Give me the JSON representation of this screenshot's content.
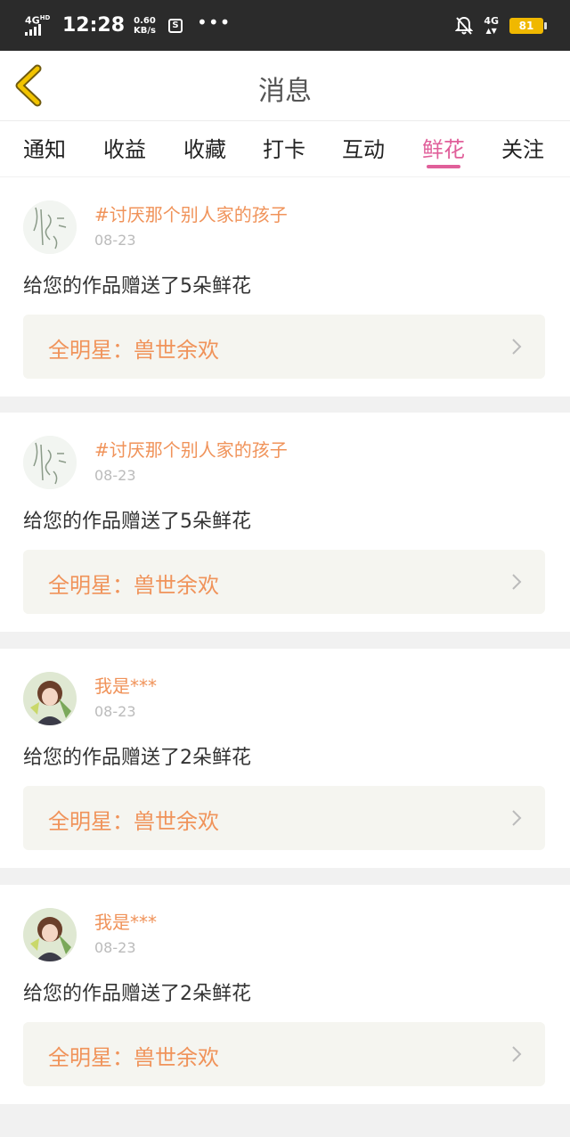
{
  "status_bar": {
    "network": "4G",
    "network_sup": "HD",
    "time": "12:28",
    "speed_value": "0.60",
    "speed_unit": "KB/s",
    "right_network": "4G",
    "battery": "81"
  },
  "header": {
    "title": "消息"
  },
  "tabs": [
    {
      "label": "通知"
    },
    {
      "label": "收益"
    },
    {
      "label": "收藏"
    },
    {
      "label": "打卡"
    },
    {
      "label": "互动"
    },
    {
      "label": "鲜花",
      "active": true
    },
    {
      "label": "关注"
    }
  ],
  "items": [
    {
      "name": "#讨厌那个别人家的孩子",
      "date": "08-23",
      "message": "给您的作品赠送了5朵鲜花",
      "work": "全明星：兽世余欢",
      "avatar": "sketch-avatar"
    },
    {
      "name": "#讨厌那个别人家的孩子",
      "date": "08-23",
      "message": "给您的作品赠送了5朵鲜花",
      "work": "全明星：兽世余欢",
      "avatar": "sketch-avatar"
    },
    {
      "name": "我是***",
      "date": "08-23",
      "message": "给您的作品赠送了2朵鲜花",
      "work": "全明星：兽世余欢",
      "avatar": "anime-girl-avatar"
    },
    {
      "name": "我是***",
      "date": "08-23",
      "message": "给您的作品赠送了2朵鲜花",
      "work": "全明星：兽世余欢",
      "avatar": "anime-girl-avatar"
    }
  ],
  "colors": {
    "accent": "#e05f9a",
    "name_orange": "#f0935a",
    "back_arrow": "#e8b700",
    "battery": "#f0b800"
  }
}
